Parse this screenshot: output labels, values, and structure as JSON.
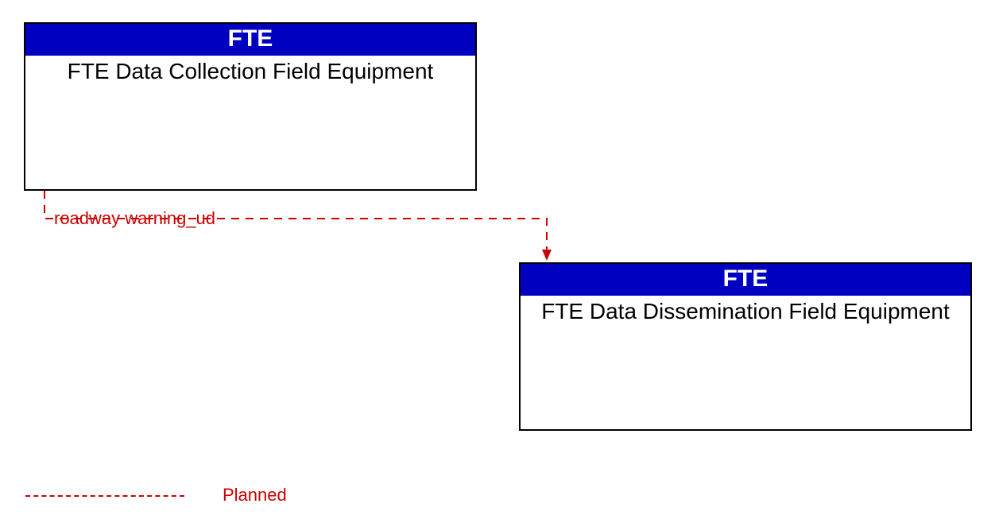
{
  "nodes": {
    "source": {
      "header": "FTE",
      "title": "FTE Data Collection Field Equipment"
    },
    "target": {
      "header": "FTE",
      "title": "FTE Data Dissemination Field Equipment"
    }
  },
  "flow": {
    "label": "roadway warning_ud",
    "status": "Planned"
  },
  "legend": {
    "planned": "Planned"
  }
}
